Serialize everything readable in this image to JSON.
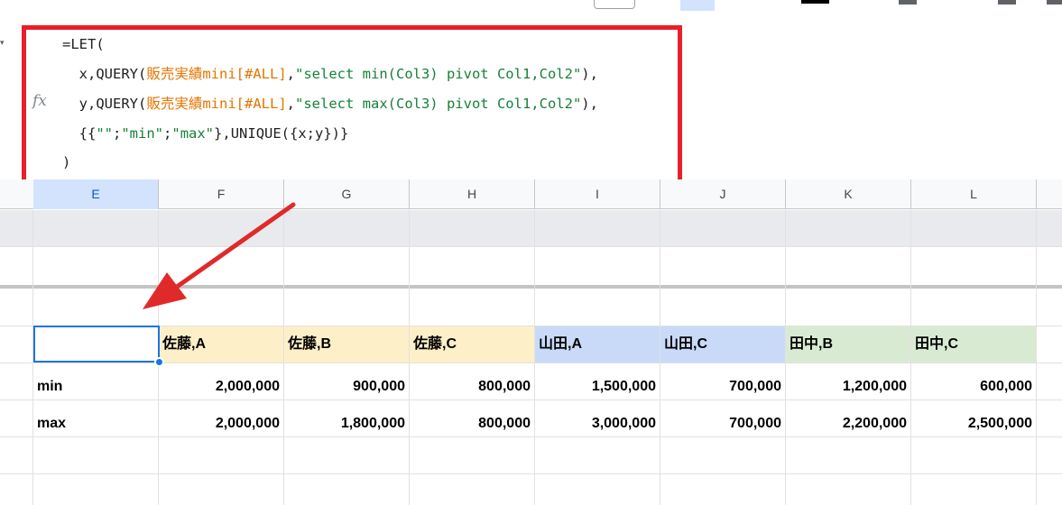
{
  "formula": {
    "lines": [
      {
        "parts": [
          {
            "t": "=LET(",
            "c": ""
          }
        ]
      },
      {
        "parts": [
          {
            "t": "  x,QUERY(",
            "c": ""
          },
          {
            "t": "販売実績mini[#ALL]",
            "c": "orange"
          },
          {
            "t": ",",
            "c": ""
          },
          {
            "t": "\"select min(Col3) pivot Col1,Col2\"",
            "c": "green"
          },
          {
            "t": "),",
            "c": ""
          }
        ]
      },
      {
        "parts": [
          {
            "t": "  y,QUERY(",
            "c": ""
          },
          {
            "t": "販売実績mini[#ALL]",
            "c": "orange"
          },
          {
            "t": ",",
            "c": ""
          },
          {
            "t": "\"select max(Col3) pivot Col1,Col2\"",
            "c": "green"
          },
          {
            "t": "),",
            "c": ""
          }
        ]
      },
      {
        "parts": [
          {
            "t": "  {{",
            "c": ""
          },
          {
            "t": "\"\"",
            "c": "green"
          },
          {
            "t": ";",
            "c": ""
          },
          {
            "t": "\"min\"",
            "c": "green"
          },
          {
            "t": ";",
            "c": ""
          },
          {
            "t": "\"max\"",
            "c": "green"
          },
          {
            "t": "},UNIQUE({x;y})}",
            "c": ""
          }
        ]
      },
      {
        "parts": [
          {
            "t": ")",
            "c": ""
          }
        ]
      }
    ],
    "fx_label": "fx"
  },
  "columns": [
    "E",
    "F",
    "G",
    "H",
    "I",
    "J",
    "K",
    "L"
  ],
  "selected_column": "E",
  "table": {
    "headers": [
      "",
      "佐藤,A",
      "佐藤,B",
      "佐藤,C",
      "山田,A",
      "山田,C",
      "田中,B",
      "田中,C"
    ],
    "header_colors": [
      "#ffffff",
      "#fdefc8",
      "#fdefc8",
      "#fdefc8",
      "#c9daf8",
      "#c9daf8",
      "#d9ead3",
      "#d9ead3"
    ],
    "rows": [
      {
        "label": "min",
        "values": [
          "2,000,000",
          "900,000",
          "800,000",
          "1,500,000",
          "700,000",
          "1,200,000",
          "600,000"
        ]
      },
      {
        "label": "max",
        "values": [
          "2,000,000",
          "1,800,000",
          "800,000",
          "3,000,000",
          "700,000",
          "2,200,000",
          "2,500,000"
        ]
      }
    ]
  },
  "colors": {
    "highlight_box": "#e8202a",
    "selection": "#1a73e8"
  }
}
